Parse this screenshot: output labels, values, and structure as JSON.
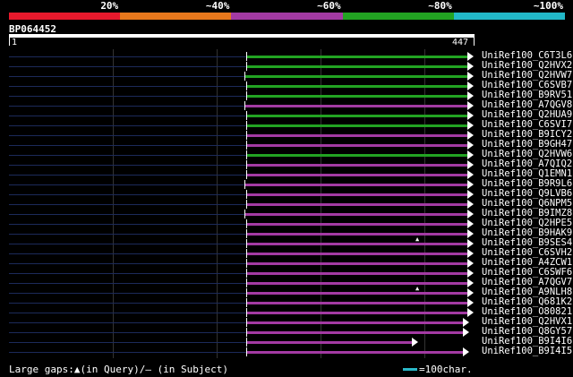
{
  "legend": {
    "colors": [
      "#e8192c",
      "#e8781c",
      "#a33aa3",
      "#22a322",
      "#22b8c8"
    ],
    "labels": [
      "20%",
      "~40%",
      "~60%",
      "~80%",
      "~100%"
    ]
  },
  "query": {
    "id": "BP064452",
    "start": "1",
    "end": "447"
  },
  "hits": [
    {
      "name": "UniRef100_C6T3L6",
      "color": "#22a322",
      "start": 0.509,
      "large_gap_query": false
    },
    {
      "name": "UniRef100_Q2HVX2",
      "color": "#22a322",
      "start": 0.509,
      "large_gap_query": false
    },
    {
      "name": "UniRef100_Q2HVW7",
      "color": "#22a322",
      "start": 0.505,
      "large_gap_query": false
    },
    {
      "name": "UniRef100_C6SVB7",
      "color": "#22a322",
      "start": 0.509,
      "large_gap_query": false
    },
    {
      "name": "UniRef100_B9RV51",
      "color": "#22a322",
      "start": 0.509,
      "large_gap_query": false
    },
    {
      "name": "UniRef100_A7QGV8",
      "color": "#a33aa3",
      "start": 0.505,
      "large_gap_query": false
    },
    {
      "name": "UniRef100_Q2HUA9",
      "color": "#22a322",
      "start": 0.509,
      "large_gap_query": false
    },
    {
      "name": "UniRef100_C6SVI7",
      "color": "#22a322",
      "start": 0.509,
      "large_gap_query": false
    },
    {
      "name": "UniRef100_B9ICY2",
      "color": "#a33aa3",
      "start": 0.509,
      "large_gap_query": false
    },
    {
      "name": "UniRef100_B9GH47",
      "color": "#a33aa3",
      "start": 0.509,
      "large_gap_query": false
    },
    {
      "name": "UniRef100_Q2HVW6",
      "color": "#22a322",
      "start": 0.509,
      "large_gap_query": false
    },
    {
      "name": "UniRef100_A7QIQ2",
      "color": "#a33aa3",
      "start": 0.509,
      "large_gap_query": false
    },
    {
      "name": "UniRef100_Q1EMN1",
      "color": "#a33aa3",
      "start": 0.509,
      "large_gap_query": false
    },
    {
      "name": "UniRef100_B9R9L6",
      "color": "#a33aa3",
      "start": 0.505,
      "large_gap_query": false
    },
    {
      "name": "UniRef100_Q9LVB6",
      "color": "#a33aa3",
      "start": 0.509,
      "large_gap_query": false
    },
    {
      "name": "UniRef100_Q6NPM5",
      "color": "#a33aa3",
      "start": 0.509,
      "large_gap_query": false
    },
    {
      "name": "UniRef100_B9IMZ8",
      "color": "#a33aa3",
      "start": 0.505,
      "large_gap_query": false
    },
    {
      "name": "UniRef100_Q2HPE5",
      "color": "#a33aa3",
      "start": 0.509,
      "large_gap_query": false
    },
    {
      "name": "UniRef100_B9HAK9",
      "color": "#a33aa3",
      "start": 0.509,
      "large_gap_query": false
    },
    {
      "name": "UniRef100_B9SES4",
      "color": "#a33aa3",
      "start": 0.509,
      "large_gap_query": true
    },
    {
      "name": "UniRef100_C6SVH2",
      "color": "#a33aa3",
      "start": 0.509,
      "large_gap_query": false
    },
    {
      "name": "UniRef100_A4ZCW1",
      "color": "#a33aa3",
      "start": 0.509,
      "large_gap_query": false
    },
    {
      "name": "UniRef100_C6SWF6",
      "color": "#a33aa3",
      "start": 0.509,
      "large_gap_query": false
    },
    {
      "name": "UniRef100_A7QGV7",
      "color": "#a33aa3",
      "start": 0.509,
      "large_gap_query": false
    },
    {
      "name": "UniRef100_A9NLH8",
      "color": "#a33aa3",
      "start": 0.509,
      "large_gap_query": true
    },
    {
      "name": "UniRef100_Q681K2",
      "color": "#a33aa3",
      "start": 0.509,
      "large_gap_query": false
    },
    {
      "name": "UniRef100_O80821",
      "color": "#a33aa3",
      "start": 0.509,
      "large_gap_query": false
    },
    {
      "name": "UniRef100_Q2HVX1",
      "color": "#a33aa3",
      "start": 0.509,
      "large_gap_query": false
    },
    {
      "name": "UniRef100_Q8GY57",
      "color": "#a33aa3",
      "start": 0.509,
      "large_gap_query": false
    },
    {
      "name": "UniRef100_B9I4I6",
      "color": "#a33aa3",
      "start": 0.509,
      "large_gap_query": false
    },
    {
      "name": "UniRef100_B9I4I5",
      "color": "#a33aa3",
      "start": 0.509,
      "large_gap_query": false
    }
  ],
  "hit_ends": [
    1.0,
    1.0,
    1.0,
    1.0,
    1.0,
    1.0,
    1.0,
    1.0,
    1.0,
    1.0,
    1.0,
    1.0,
    1.0,
    1.0,
    1.0,
    1.0,
    1.0,
    1.0,
    1.0,
    1.0,
    1.0,
    1.0,
    1.0,
    1.0,
    1.0,
    1.0,
    1.0,
    0.99,
    0.99,
    0.88,
    0.99
  ],
  "footer": {
    "gaps_text": "Large gaps:▲(in Query)/— (in Subject)",
    "scale_text": "=100char."
  }
}
